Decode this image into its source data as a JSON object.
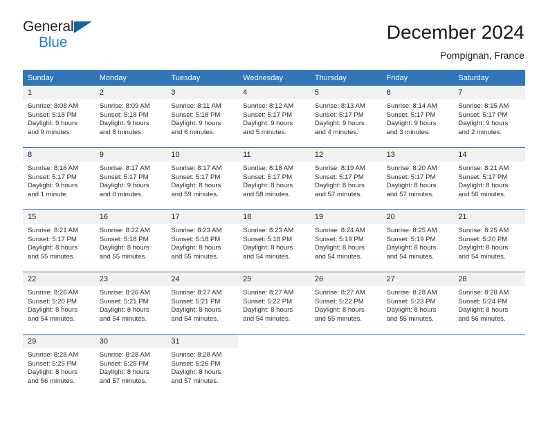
{
  "brand": {
    "name_part1": "General",
    "name_part2": "Blue",
    "flag_icon": "triangle-flag-icon"
  },
  "header": {
    "title": "December 2024",
    "subtitle": "Pompignan, France"
  },
  "colors": {
    "header_blue": "#3275b8",
    "brand_blue": "#1f7fc4",
    "flag_blue": "#1464a5",
    "day_number_band": "#f1f1f1",
    "text": "#2b2b2b"
  },
  "calendar": {
    "weekdays": [
      "Sunday",
      "Monday",
      "Tuesday",
      "Wednesday",
      "Thursday",
      "Friday",
      "Saturday"
    ],
    "weeks": [
      [
        {
          "day": "1",
          "lines": [
            "Sunrise: 8:08 AM",
            "Sunset: 5:18 PM",
            "Daylight: 9 hours",
            "and 9 minutes."
          ]
        },
        {
          "day": "2",
          "lines": [
            "Sunrise: 8:09 AM",
            "Sunset: 5:18 PM",
            "Daylight: 9 hours",
            "and 8 minutes."
          ]
        },
        {
          "day": "3",
          "lines": [
            "Sunrise: 8:11 AM",
            "Sunset: 5:18 PM",
            "Daylight: 9 hours",
            "and 6 minutes."
          ]
        },
        {
          "day": "4",
          "lines": [
            "Sunrise: 8:12 AM",
            "Sunset: 5:17 PM",
            "Daylight: 9 hours",
            "and 5 minutes."
          ]
        },
        {
          "day": "5",
          "lines": [
            "Sunrise: 8:13 AM",
            "Sunset: 5:17 PM",
            "Daylight: 9 hours",
            "and 4 minutes."
          ]
        },
        {
          "day": "6",
          "lines": [
            "Sunrise: 8:14 AM",
            "Sunset: 5:17 PM",
            "Daylight: 9 hours",
            "and 3 minutes."
          ]
        },
        {
          "day": "7",
          "lines": [
            "Sunrise: 8:15 AM",
            "Sunset: 5:17 PM",
            "Daylight: 9 hours",
            "and 2 minutes."
          ]
        }
      ],
      [
        {
          "day": "8",
          "lines": [
            "Sunrise: 8:16 AM",
            "Sunset: 5:17 PM",
            "Daylight: 9 hours",
            "and 1 minute."
          ]
        },
        {
          "day": "9",
          "lines": [
            "Sunrise: 8:17 AM",
            "Sunset: 5:17 PM",
            "Daylight: 9 hours",
            "and 0 minutes."
          ]
        },
        {
          "day": "10",
          "lines": [
            "Sunrise: 8:17 AM",
            "Sunset: 5:17 PM",
            "Daylight: 8 hours",
            "and 59 minutes."
          ]
        },
        {
          "day": "11",
          "lines": [
            "Sunrise: 8:18 AM",
            "Sunset: 5:17 PM",
            "Daylight: 8 hours",
            "and 58 minutes."
          ]
        },
        {
          "day": "12",
          "lines": [
            "Sunrise: 8:19 AM",
            "Sunset: 5:17 PM",
            "Daylight: 8 hours",
            "and 57 minutes."
          ]
        },
        {
          "day": "13",
          "lines": [
            "Sunrise: 8:20 AM",
            "Sunset: 5:17 PM",
            "Daylight: 8 hours",
            "and 57 minutes."
          ]
        },
        {
          "day": "14",
          "lines": [
            "Sunrise: 8:21 AM",
            "Sunset: 5:17 PM",
            "Daylight: 8 hours",
            "and 56 minutes."
          ]
        }
      ],
      [
        {
          "day": "15",
          "lines": [
            "Sunrise: 8:21 AM",
            "Sunset: 5:17 PM",
            "Daylight: 8 hours",
            "and 55 minutes."
          ]
        },
        {
          "day": "16",
          "lines": [
            "Sunrise: 8:22 AM",
            "Sunset: 5:18 PM",
            "Daylight: 8 hours",
            "and 55 minutes."
          ]
        },
        {
          "day": "17",
          "lines": [
            "Sunrise: 8:23 AM",
            "Sunset: 5:18 PM",
            "Daylight: 8 hours",
            "and 55 minutes."
          ]
        },
        {
          "day": "18",
          "lines": [
            "Sunrise: 8:23 AM",
            "Sunset: 5:18 PM",
            "Daylight: 8 hours",
            "and 54 minutes."
          ]
        },
        {
          "day": "19",
          "lines": [
            "Sunrise: 8:24 AM",
            "Sunset: 5:19 PM",
            "Daylight: 8 hours",
            "and 54 minutes."
          ]
        },
        {
          "day": "20",
          "lines": [
            "Sunrise: 8:25 AM",
            "Sunset: 5:19 PM",
            "Daylight: 8 hours",
            "and 54 minutes."
          ]
        },
        {
          "day": "21",
          "lines": [
            "Sunrise: 8:25 AM",
            "Sunset: 5:20 PM",
            "Daylight: 8 hours",
            "and 54 minutes."
          ]
        }
      ],
      [
        {
          "day": "22",
          "lines": [
            "Sunrise: 8:26 AM",
            "Sunset: 5:20 PM",
            "Daylight: 8 hours",
            "and 54 minutes."
          ]
        },
        {
          "day": "23",
          "lines": [
            "Sunrise: 8:26 AM",
            "Sunset: 5:21 PM",
            "Daylight: 8 hours",
            "and 54 minutes."
          ]
        },
        {
          "day": "24",
          "lines": [
            "Sunrise: 8:27 AM",
            "Sunset: 5:21 PM",
            "Daylight: 8 hours",
            "and 54 minutes."
          ]
        },
        {
          "day": "25",
          "lines": [
            "Sunrise: 8:27 AM",
            "Sunset: 5:22 PM",
            "Daylight: 8 hours",
            "and 54 minutes."
          ]
        },
        {
          "day": "26",
          "lines": [
            "Sunrise: 8:27 AM",
            "Sunset: 5:22 PM",
            "Daylight: 8 hours",
            "and 55 minutes."
          ]
        },
        {
          "day": "27",
          "lines": [
            "Sunrise: 8:28 AM",
            "Sunset: 5:23 PM",
            "Daylight: 8 hours",
            "and 55 minutes."
          ]
        },
        {
          "day": "28",
          "lines": [
            "Sunrise: 8:28 AM",
            "Sunset: 5:24 PM",
            "Daylight: 8 hours",
            "and 56 minutes."
          ]
        }
      ],
      [
        {
          "day": "29",
          "lines": [
            "Sunrise: 8:28 AM",
            "Sunset: 5:25 PM",
            "Daylight: 8 hours",
            "and 56 minutes."
          ]
        },
        {
          "day": "30",
          "lines": [
            "Sunrise: 8:28 AM",
            "Sunset: 5:25 PM",
            "Daylight: 8 hours",
            "and 57 minutes."
          ]
        },
        {
          "day": "31",
          "lines": [
            "Sunrise: 8:28 AM",
            "Sunset: 5:26 PM",
            "Daylight: 8 hours",
            "and 57 minutes."
          ]
        },
        {
          "day": "",
          "lines": []
        },
        {
          "day": "",
          "lines": []
        },
        {
          "day": "",
          "lines": []
        },
        {
          "day": "",
          "lines": []
        }
      ]
    ]
  }
}
